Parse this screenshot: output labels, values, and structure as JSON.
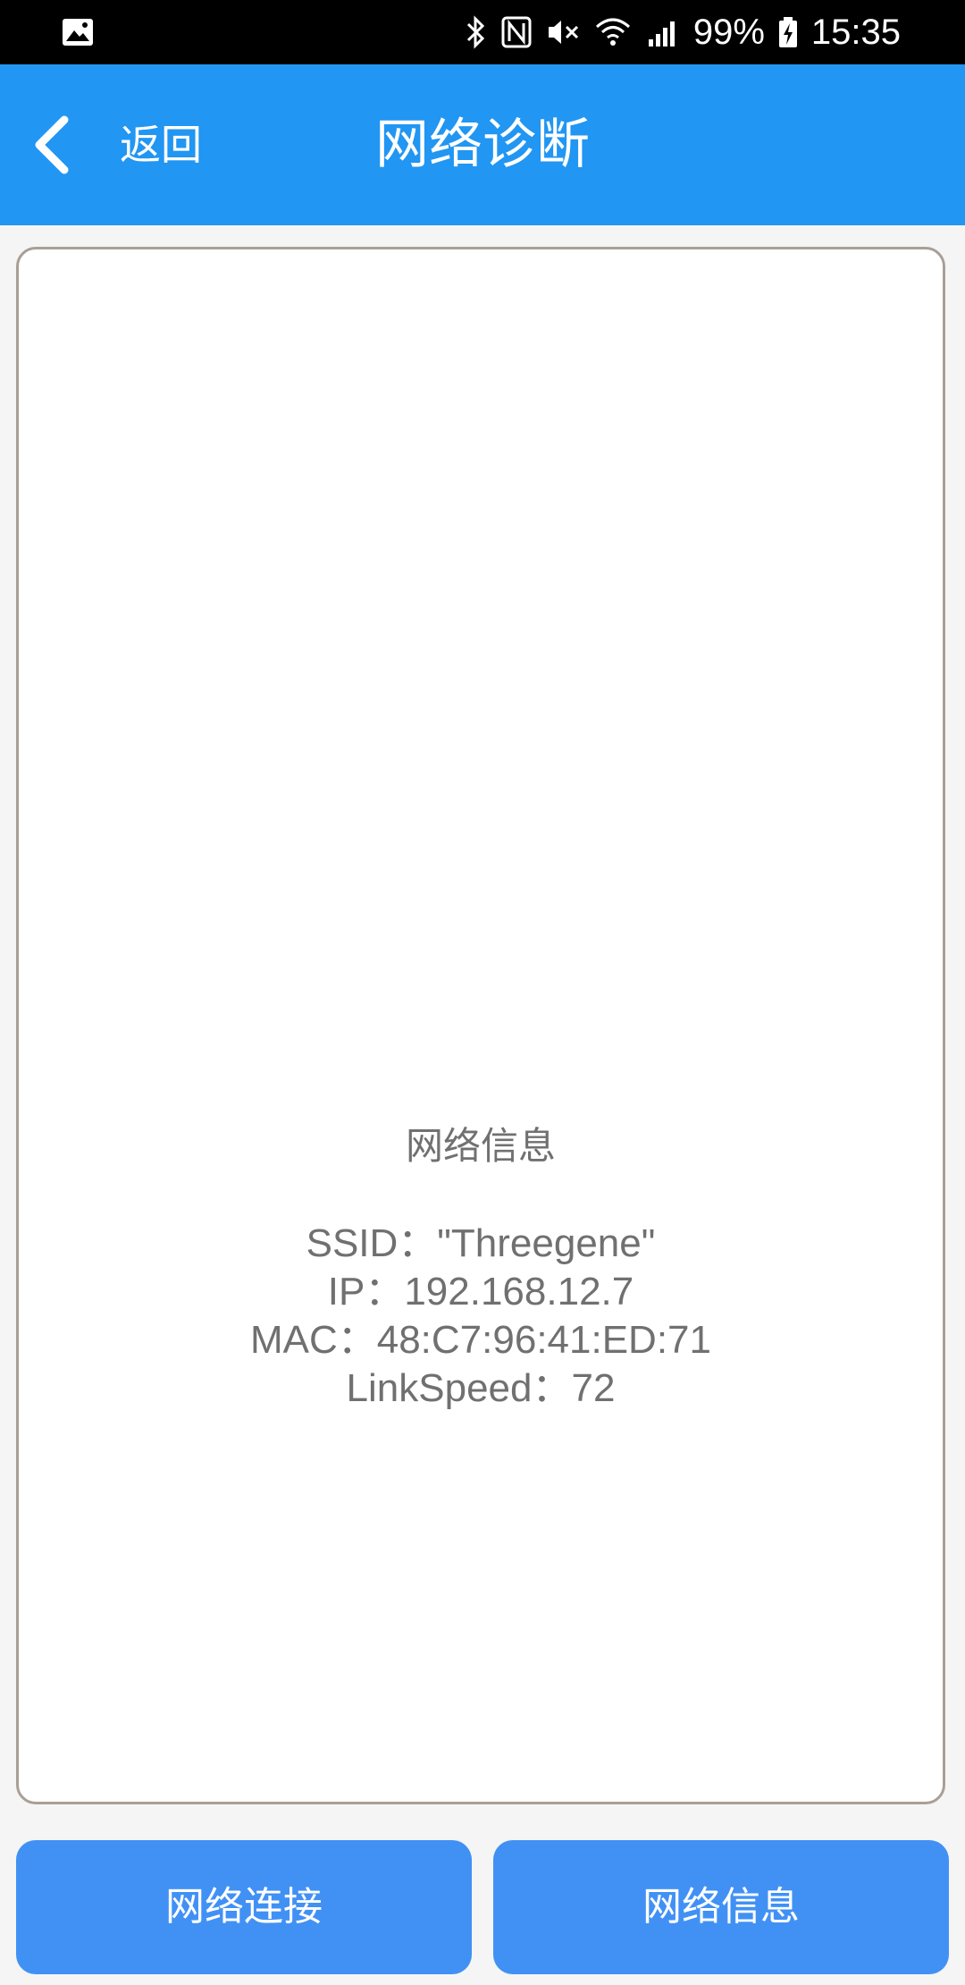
{
  "status_bar": {
    "left_icon": "image-icon",
    "icons": [
      "bluetooth-icon",
      "nfc-icon",
      "mute-icon",
      "wifi-icon",
      "signal-icon"
    ],
    "battery": "99%",
    "battery_icon": "battery-charging-icon",
    "time": "15:35"
  },
  "header": {
    "back_icon": "chevron-left-icon",
    "back_label": "返回",
    "title": "网络诊断",
    "background_color": "#2196f3"
  },
  "info_card": {
    "title": "网络信息",
    "lines": [
      "SSID：\"Threegene\"",
      "IP：192.168.12.7",
      "MAC：48:C7:96:41:ED:71",
      "LinkSpeed：72"
    ]
  },
  "buttons": {
    "network_connect": "网络连接",
    "network_info": "网络信息",
    "button_color": "#4191f5"
  }
}
